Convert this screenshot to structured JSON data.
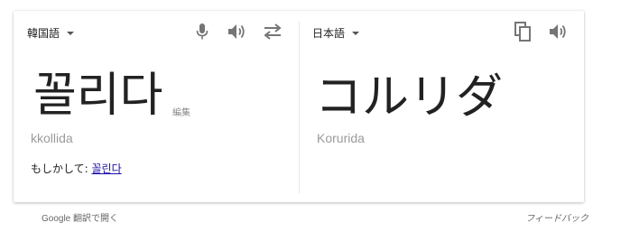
{
  "source": {
    "language": "韓国語",
    "text": "꼴리다",
    "edit_label": "編集",
    "transliteration": "kkollida",
    "suggestion_prefix": "もしかして: ",
    "suggestion_link": "꼴린다"
  },
  "target": {
    "language": "日本語",
    "text": "コルリダ",
    "transliteration": "Korurida"
  },
  "icons": {
    "source_mic": "mic-icon",
    "source_speaker": "speaker-icon",
    "swap": "swap-icon",
    "target_copy": "copy-icon",
    "target_speaker": "speaker-icon"
  },
  "footer": {
    "open_link": "Google 翻訳で開く",
    "feedback": "フィードバック"
  },
  "colors": {
    "icon": "#757575",
    "link": "#1a0dab",
    "muted_text": "#9a9a9a"
  }
}
